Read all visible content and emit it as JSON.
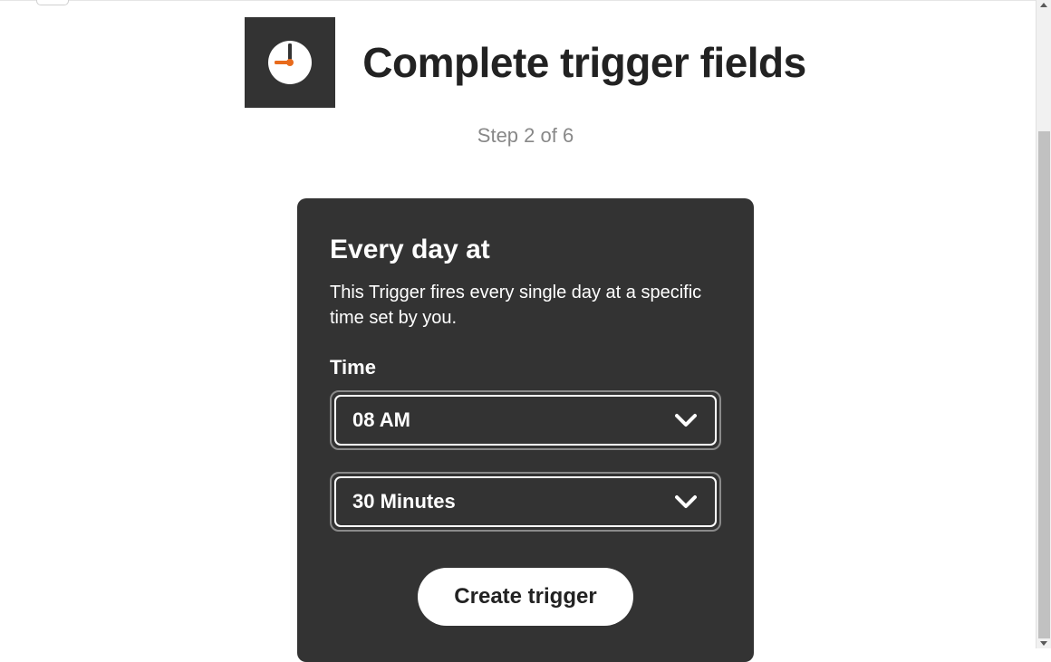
{
  "header": {
    "title": "Complete trigger fields",
    "step_label": "Step 2 of 6"
  },
  "card": {
    "title": "Every day at",
    "description": "This Trigger fires every single day at a specific time set by you.",
    "time_label": "Time",
    "hour_value": "08 AM",
    "minute_value": "30 Minutes",
    "create_button": "Create trigger"
  },
  "colors": {
    "tile_bg": "#333333",
    "clock_accent": "#e86b1c"
  }
}
